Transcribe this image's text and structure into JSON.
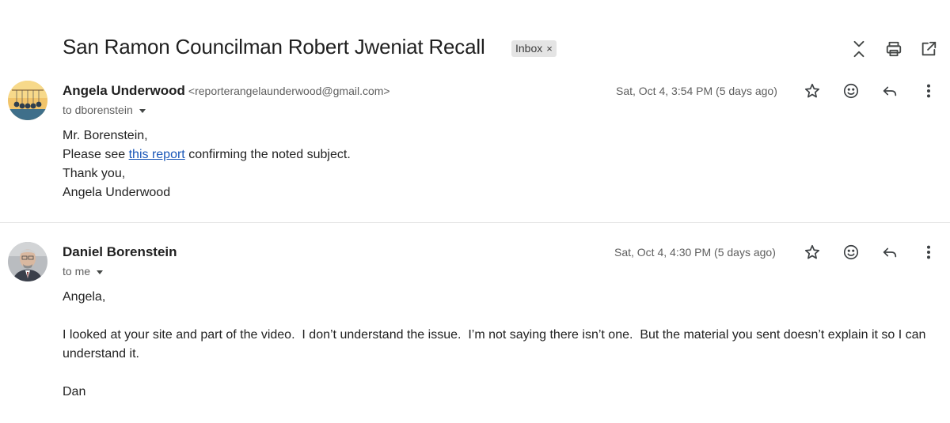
{
  "thread": {
    "subject": "San Ramon Councilman Robert Jweniat Recall",
    "label": "Inbox",
    "label_remove": "×"
  },
  "toolbar": {
    "icons": [
      "collapse-all-icon",
      "print-icon",
      "open-in-new-window-icon"
    ]
  },
  "messages": [
    {
      "sender_name": "Angela Underwood",
      "sender_email": "<reporterangelaunderwood@gmail.com>",
      "recipient": "to dborenstein",
      "date": "Sat, Oct 4, 3:54 PM (5 days ago)",
      "body": {
        "greeting": "Mr. Borenstein,",
        "line2_before": "Please see ",
        "line2_link": "this report",
        "line2_after": " confirming the noted subject.",
        "line3": "Thank you,",
        "line4": "Angela Underwood"
      }
    },
    {
      "sender_name": "Daniel Borenstein",
      "recipient": "to me",
      "date": "Sat, Oct 4, 4:30 PM (5 days ago)",
      "body": {
        "greeting": "Angela,",
        "paragraph": "I looked at your site and part of the video.  I don’t understand the issue.  I’m not saying there isn’t one.  But the material you sent doesn’t explain it so I can understand it.",
        "signoff": "Dan"
      }
    }
  ],
  "colors": {
    "link": "#1a57b8",
    "label_chip": "#e4e4e4",
    "muted_text": "#5e5e5e"
  }
}
